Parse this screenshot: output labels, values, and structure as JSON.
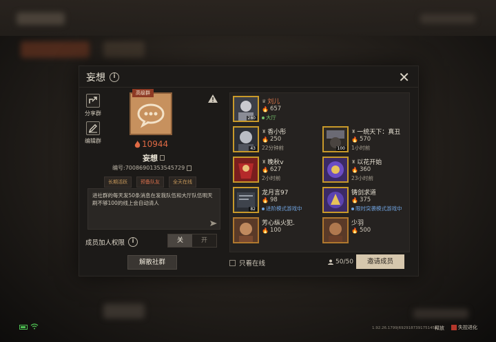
{
  "dialog": {
    "title": "妄想",
    "close": "✕"
  },
  "left": {
    "share_label": "分享群",
    "edit_label": "编辑群",
    "avatar_tag": "高级群",
    "fire_count": "10944",
    "club_name": "妄想",
    "club_id": "编号:70086901353545729",
    "tags": [
      "长期活跃",
      "预备队友",
      "全天在线"
    ],
    "notice": "进社群的每天发50条消息在发我队伍和大厅队伍明天刷不够100的线上会自动清人",
    "perm_label": "成员加人权限",
    "toggle_off": "关",
    "toggle_on": "开",
    "disband": "解散社群"
  },
  "members": [
    {
      "name": "刘儿",
      "score": "657",
      "status": "大厅",
      "level": "280",
      "status_color": "green",
      "name_color": "orange"
    },
    {
      "name": "香小彤",
      "score": "250",
      "status": "22分钟前",
      "level": "43",
      "status_color": "gray"
    },
    {
      "name": "一统天下：真丑",
      "score": "570",
      "status": "1小时前",
      "level": "100",
      "status_color": "gray"
    },
    {
      "name": "晚秋v",
      "score": "627",
      "status": "2小时前",
      "level": "",
      "status_color": "gray"
    },
    {
      "name": "以花开始",
      "score": "360",
      "status": "23小时前",
      "level": "",
      "status_color": "gray"
    },
    {
      "name": "龙月言97",
      "score": "98",
      "status": "进阶模式游戏中",
      "level": "82",
      "status_color": "blue"
    },
    {
      "name": "铸剑求道",
      "score": "375",
      "status": "限时突袭模式游戏中",
      "level": "",
      "status_color": "blue"
    },
    {
      "name": "芳心纵火犯.",
      "score": "100",
      "status": "",
      "level": "",
      "status_color": "gray"
    },
    {
      "name": "少羽",
      "score": "500",
      "status": "",
      "level": "",
      "status_color": "gray"
    }
  ],
  "bottom": {
    "only_online": "只看在线",
    "count": "50/50",
    "invite": "邀请成员"
  },
  "footer": {
    "version": "1.92.26.1799|6929187391751458",
    "item1": "释放",
    "item2": "失控进化"
  },
  "colors": {
    "accent": "#e06a44",
    "invite_bg": "#d6c7ad",
    "green_status": "#74c06b",
    "blue_status": "#6fa3e0"
  }
}
